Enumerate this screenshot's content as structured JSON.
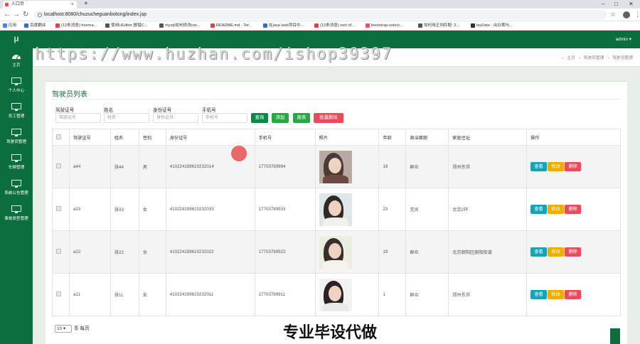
{
  "browser": {
    "tab_title": "入口页",
    "url": "localhost:8080/chuzucheguanlixitong/index.jsp",
    "bookmarks": [
      "应用",
      "百度翻译",
      "(12条消息) freema...",
      "使用UEditor 报错C...",
      "mysql如何修改roo...",
      "README.md · Ter...",
      "在java web项目中...",
      "(12条消息) root of...",
      "bootstrap-select...",
      "如何用正则匹配: 2...",
      "layDate - 出日期与..."
    ]
  },
  "sidebar": {
    "logo": "μ",
    "items": [
      {
        "label": "主页",
        "icon": "dashboard-icon"
      },
      {
        "label": "个人中心",
        "icon": "monitor-icon"
      },
      {
        "label": "员工管理",
        "icon": "monitor-icon"
      },
      {
        "label": "驾驶员管理",
        "icon": "monitor-icon"
      },
      {
        "label": "车辆管理",
        "icon": "monitor-icon"
      },
      {
        "label": "系统公告管理",
        "icon": "monitor-icon"
      },
      {
        "label": "事故类型管理",
        "icon": "monitor-icon"
      }
    ]
  },
  "header": {
    "user": "admin ▾"
  },
  "breadcrumb": {
    "home": "主页",
    "section": "驾驶员管理",
    "page": "驾驶员管理"
  },
  "panel": {
    "title": "驾驶员列表"
  },
  "filters": [
    {
      "label": "驾驶证号",
      "placeholder": "驾驶证号"
    },
    {
      "label": "姓名",
      "placeholder": "姓名"
    },
    {
      "label": "身份证号",
      "placeholder": "身份证号"
    },
    {
      "label": "手机号",
      "placeholder": "手机号"
    }
  ],
  "buttons": {
    "search": "查询",
    "add": "添加",
    "report": "报表",
    "batch_delete": "批量删除"
  },
  "colors": {
    "primary": "#0b6e3c",
    "green_btn": "#28a745",
    "danger": "#e74c5c",
    "info": "#17a2b8",
    "warning": "#f0ad00"
  },
  "table": {
    "headers": [
      "驾驶证号",
      "姓名",
      "性别",
      "身份证号",
      "手机号",
      "照片",
      "年龄",
      "政治面貌",
      "家庭住址",
      "操作"
    ],
    "rows": [
      {
        "license": "a44",
        "name": "张44",
        "gender": "男",
        "id_card": "410224199610232014",
        "phone": "17703789994",
        "age": "19",
        "politics": "群众",
        "address": "郑州东郊"
      },
      {
        "license": "a33",
        "name": "张33",
        "gender": "女",
        "id_card": "410224199610232033",
        "phone": "17703789933",
        "age": "23",
        "politics": "党员",
        "address": "北京2环"
      },
      {
        "license": "a22",
        "name": "张22",
        "gender": "女",
        "id_card": "410224199610232022",
        "phone": "17703789922",
        "age": "19",
        "politics": "群众",
        "address": "北京朝阳区朝阳街道"
      },
      {
        "license": "a11",
        "name": "张11",
        "gender": "女",
        "id_card": "410224199610232011",
        "phone": "17703789911",
        "age": "1",
        "politics": "群众",
        "address": "郑州东郊"
      }
    ],
    "actions": {
      "view": "查看",
      "edit": "修改",
      "delete": "删除"
    }
  },
  "pager": {
    "page_size": "10 ▾",
    "suffix": "条 每页"
  },
  "watermarks": {
    "url": "https://www.huzhan.com/ishop39397",
    "slogan": "专业毕设代做"
  }
}
